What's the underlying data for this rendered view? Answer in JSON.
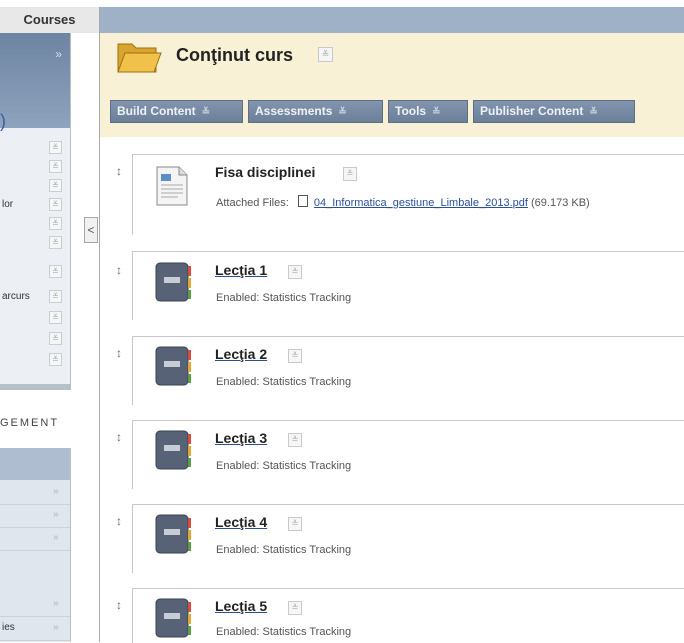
{
  "topbar": {
    "courses_tab": "Courses"
  },
  "sidebar": {
    "items": [
      {
        "label": ""
      },
      {
        "label": ""
      },
      {
        "label": ""
      },
      {
        "label": "lor"
      },
      {
        "label": ""
      },
      {
        "label": ""
      },
      {
        "label": "arcurs"
      },
      {
        "label": ""
      },
      {
        "label": ""
      },
      {
        "label": ""
      }
    ],
    "management_label": "GEMENT",
    "lower_items": [
      {
        "label": ""
      },
      {
        "label": ""
      },
      {
        "label": ""
      },
      {
        "label": ""
      },
      {
        "label": "ies"
      }
    ]
  },
  "page": {
    "title": "Conţinut curs",
    "toolbar": {
      "build_content": "Build Content",
      "assessments": "Assessments",
      "tools": "Tools",
      "publisher_content": "Publisher Content"
    }
  },
  "items": [
    {
      "title": "Fisa disciplinei",
      "attached_label": "Attached Files:",
      "file_name": "04_Informatica_gestiune_Limbale_2013.pdf",
      "file_size": "(69.173 KB)"
    },
    {
      "title": "Lecţia 1",
      "status": "Enabled:  Statistics Tracking"
    },
    {
      "title": "Lecţia 2",
      "status": "Enabled:  Statistics Tracking"
    },
    {
      "title": "Lecţia 3",
      "status": "Enabled:  Statistics Tracking"
    },
    {
      "title": "Lecţia 4",
      "status": "Enabled:  Statistics Tracking"
    },
    {
      "title": "Lecţia 5",
      "status": "Enabled:  Statistics Tracking"
    }
  ],
  "icons": {
    "chevron": "double-chevron-down-icon",
    "drag": "drag-handle-icon",
    "folder": "folder-icon",
    "document": "document-icon",
    "lesson": "notebook-icon",
    "collapse": "chevron-left-icon"
  },
  "colors": {
    "topbar": "#9fb1c6",
    "header_band": "#f8f1d6",
    "toolbar_button": "#7386a0",
    "link": "#2a4f9c"
  }
}
